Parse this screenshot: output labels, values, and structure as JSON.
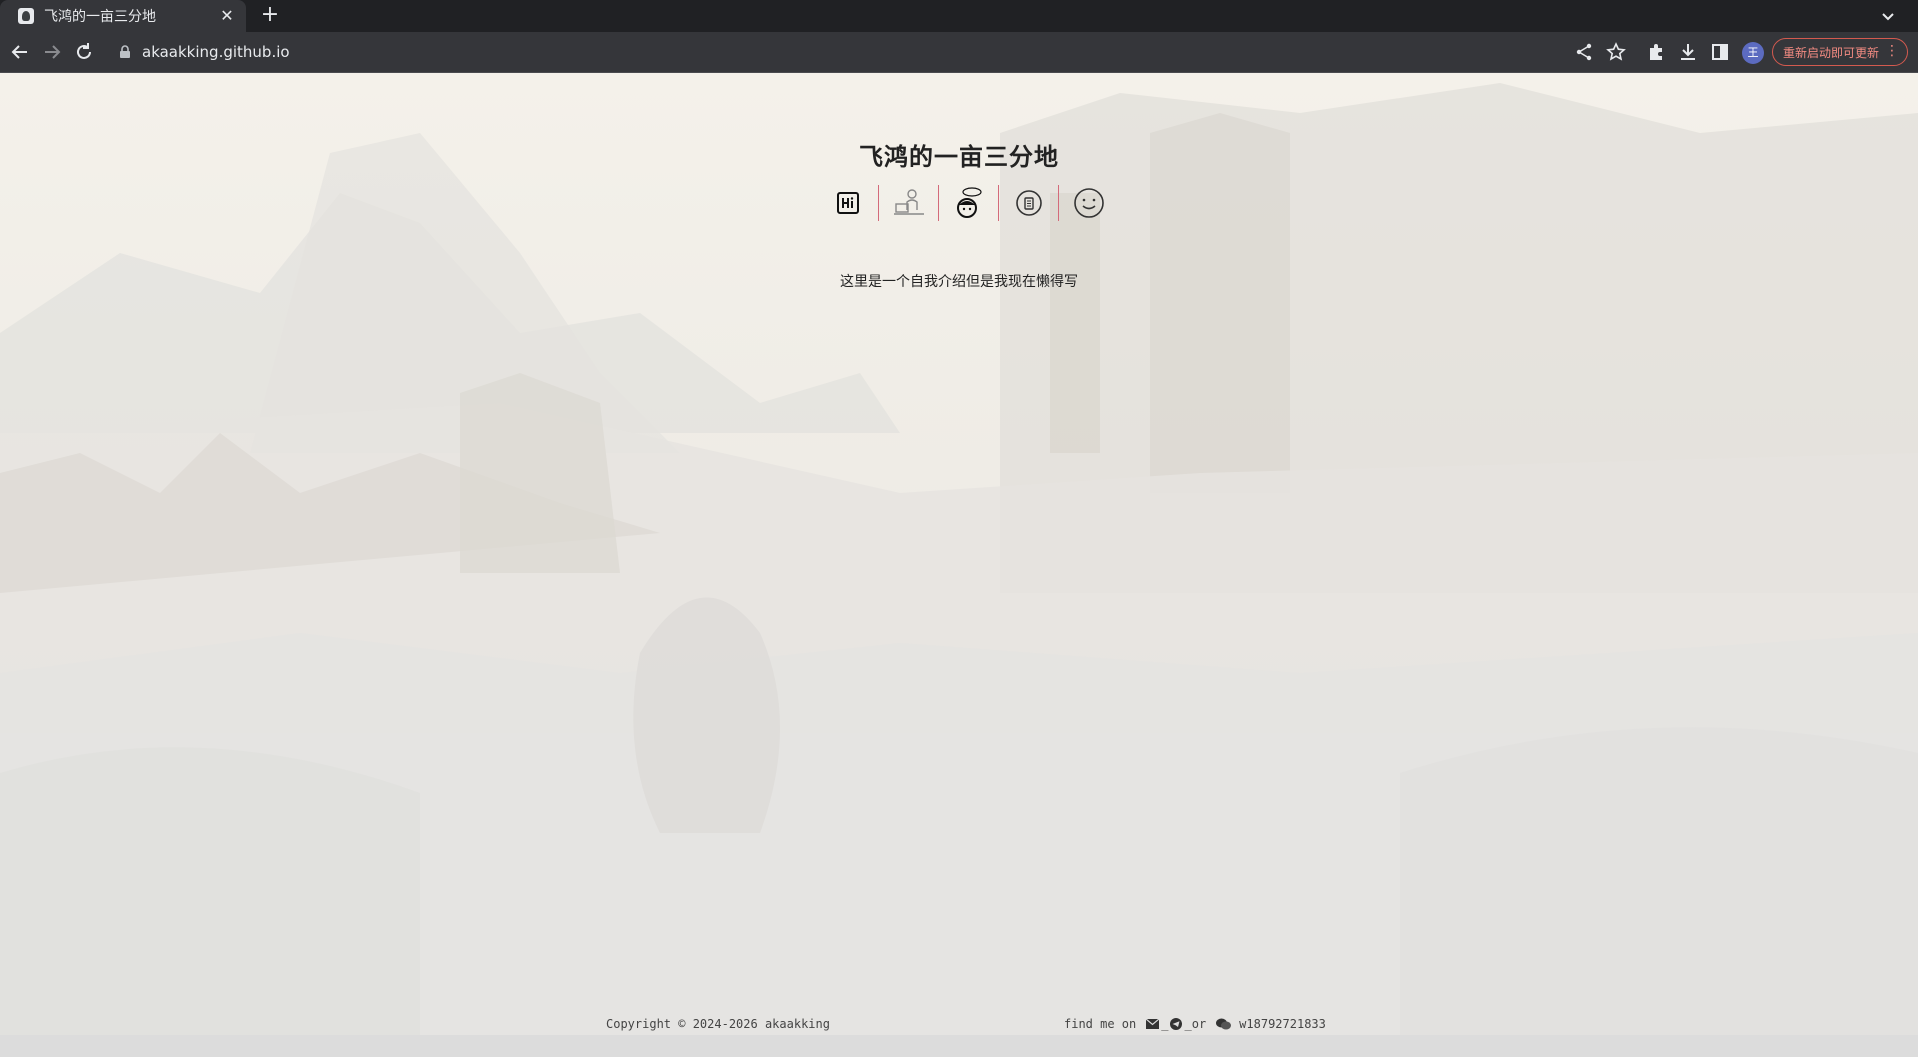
{
  "browser": {
    "tab": {
      "title": "飞鸿的一亩三分地",
      "close_icon": "close-icon"
    },
    "new_tab_label": "+",
    "url": "akaakking.github.io",
    "profile_initial": "王",
    "update_button_label": "重新启动即可更新",
    "update_menu_label": "⋮"
  },
  "page": {
    "title": "飞鸿的一亩三分地",
    "nav_icons": [
      "hi-icon",
      "coder-icon",
      "thinking-face-icon",
      "clipboard-icon",
      "smile-icon"
    ],
    "intro": "这里是一个自我介绍但是我现在懒得写",
    "footer": {
      "copyright": "Copyright © 2024-2026 akaakking",
      "find_me_prefix": "find me on",
      "or_label": "or",
      "wechat_id": "w18792721833"
    }
  },
  "colors": {
    "chrome_dark": "#202124",
    "toolbar": "#35363a",
    "update_accent": "#f28b82",
    "nav_divider": "#d46a7a"
  }
}
